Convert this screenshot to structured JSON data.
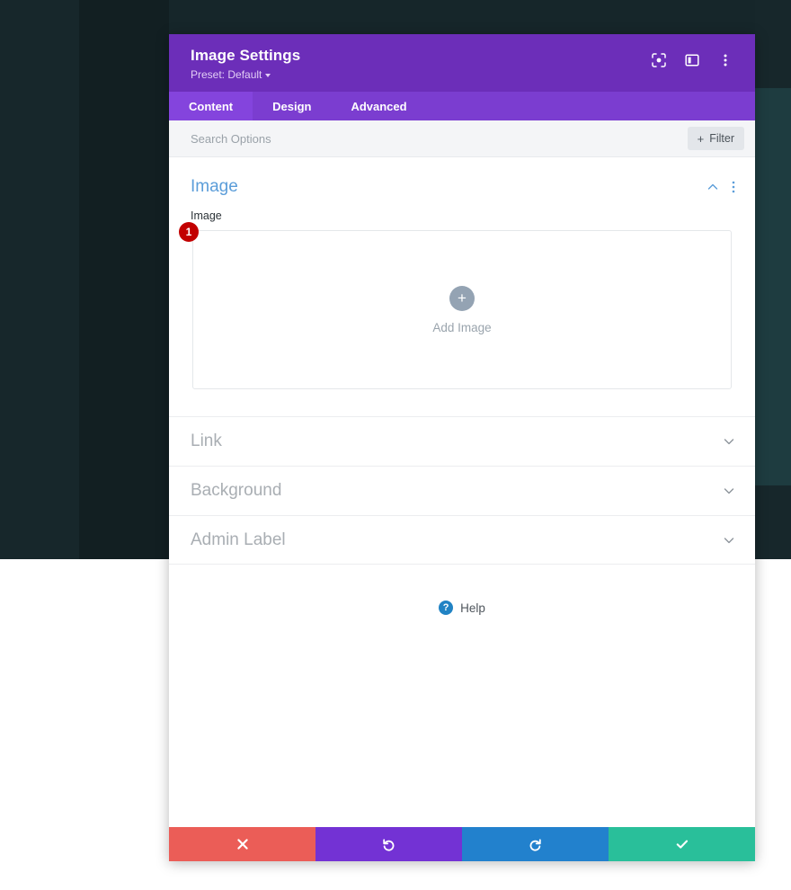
{
  "window": {
    "title": "Image Settings",
    "preset_label": "Preset: Default",
    "header_icons": [
      {
        "name": "focus-icon",
        "label": "Focus"
      },
      {
        "name": "layout-panel-icon",
        "label": "Layout"
      },
      {
        "name": "more-vertical-icon",
        "label": "More options"
      }
    ]
  },
  "tabs": [
    {
      "label": "Content",
      "active": true
    },
    {
      "label": "Design",
      "active": false
    },
    {
      "label": "Advanced",
      "active": false
    }
  ],
  "search": {
    "placeholder": "Search Options",
    "value": "",
    "filter_label": "Filter",
    "filter_plus": "+"
  },
  "image_section": {
    "title": "Image",
    "field_label": "Image",
    "upload_text": "Add Image",
    "upload_plus": "+",
    "badge": "1",
    "collapse_state": "expanded"
  },
  "collapsed_sections": [
    {
      "title": "Link"
    },
    {
      "title": "Background"
    },
    {
      "title": "Admin Label"
    }
  ],
  "help": {
    "label": "Help",
    "icon_glyph": "?"
  },
  "footer_buttons": [
    {
      "name": "cancel-button",
      "icon": "close-icon",
      "color": "#eb5d57"
    },
    {
      "name": "undo-button",
      "icon": "undo-icon",
      "color": "#7332d4"
    },
    {
      "name": "redo-button",
      "icon": "redo-icon",
      "color": "#2281cd"
    },
    {
      "name": "save-button",
      "icon": "check-icon",
      "color": "#29bf9a"
    }
  ],
  "colors": {
    "header_purple": "#6c2eb9",
    "tabbar_purple": "#7b3dd0",
    "tab_active_purple": "#8444dd",
    "section_title_blue": "#5b9dd9",
    "badge_red": "#c20000",
    "backdrop_dark": "#17272b",
    "backdrop_teal": "#1e3c40"
  }
}
